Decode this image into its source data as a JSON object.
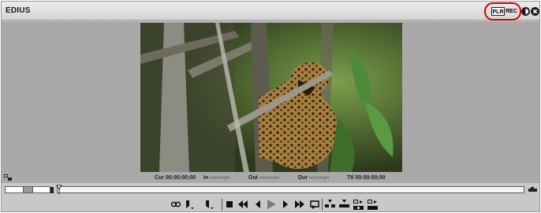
{
  "window": {
    "title": "EDIUS",
    "mode_plr_label": "PLR",
    "mode_rec_label": "REC"
  },
  "timecodes": {
    "cur": "Cur 00:00:00;00",
    "in": "In --:--:--;--",
    "out": "Out --:--:--;--",
    "dur": "Dur --:--:--;--",
    "ttl": "Ttl 00:00:00;00"
  },
  "icons": {
    "restore": "restore-icon",
    "close": "close-icon",
    "safe_area": "safe-area-icon",
    "zoom": "zoom-icon"
  },
  "toolbar": {
    "buttons": [
      "match-frame",
      "set-in",
      "set-out",
      "stop",
      "rewind",
      "step-back",
      "play",
      "step-forward",
      "fast-forward",
      "loop",
      "insert",
      "overwrite",
      "insert-timeline",
      "overwrite-timeline"
    ]
  },
  "colors": {
    "highlight": "#d40000",
    "panel": "#c8c8c8",
    "viewer": "#a9a9a9"
  }
}
